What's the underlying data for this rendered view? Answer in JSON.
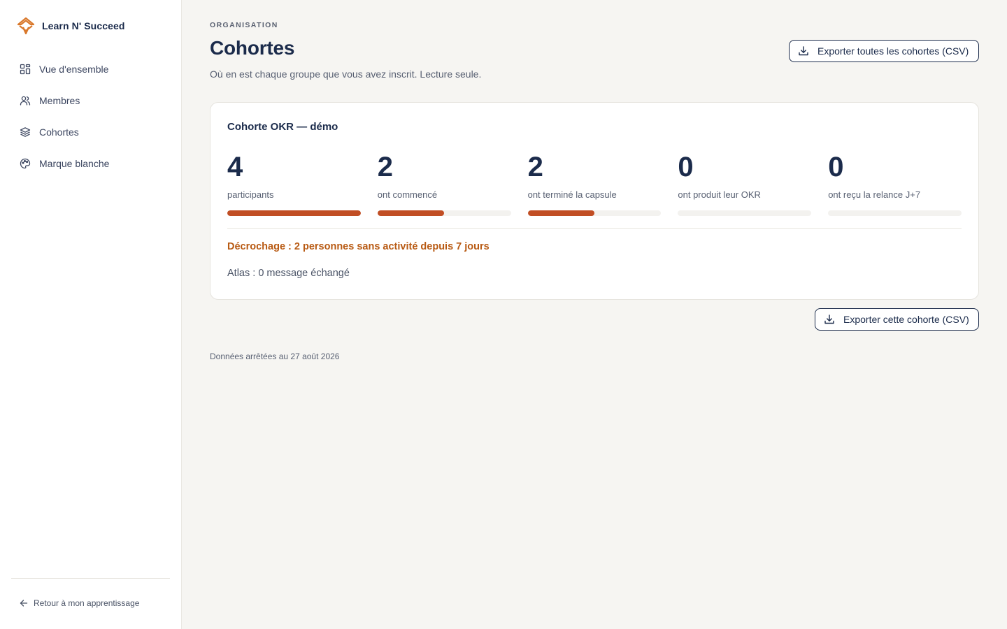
{
  "brand": {
    "name": "Learn N' Succeed",
    "logo_icon": "brand-logo-icon",
    "accent": "#d9782b"
  },
  "sidebar": {
    "items": [
      {
        "label": "Vue d'ensemble",
        "icon": "dashboard-grid-icon"
      },
      {
        "label": "Membres",
        "icon": "users-icon"
      },
      {
        "label": "Cohortes",
        "icon": "layers-icon"
      },
      {
        "label": "Marque blanche",
        "icon": "palette-icon"
      }
    ],
    "back_label": "Retour à mon apprentissage",
    "back_icon": "arrow-left-icon"
  },
  "header": {
    "eyebrow": "ORGANISATION",
    "title": "Cohortes",
    "subtitle": "Où en est chaque groupe que vous avez inscrit. Lecture seule.",
    "export_all_label": "Exporter toutes les cohortes (CSV)",
    "export_icon": "download-icon"
  },
  "cohort": {
    "title": "Cohorte OKR — démo",
    "stats": [
      {
        "value": "4",
        "label": "participants",
        "progress": 1.0
      },
      {
        "value": "2",
        "label": "ont commencé",
        "progress": 0.5
      },
      {
        "value": "2",
        "label": "ont terminé la capsule",
        "progress": 0.5
      },
      {
        "value": "0",
        "label": "ont produit leur OKR",
        "progress": 0.0
      },
      {
        "value": "0",
        "label": "ont reçu la relance J+7",
        "progress": 0.0
      }
    ],
    "alert": "Décrochage : 2 personnes sans activité depuis 7 jours",
    "atlas": "Atlas : 0 message échangé",
    "export_label": "Exporter cette cohorte (CSV)"
  },
  "footnote": "Données arrêtées au 27 août 2026",
  "colors": {
    "navy": "#1b2b4b",
    "progress": "#c14e24",
    "warning": "#b85a13",
    "background": "#f6f5f2"
  }
}
